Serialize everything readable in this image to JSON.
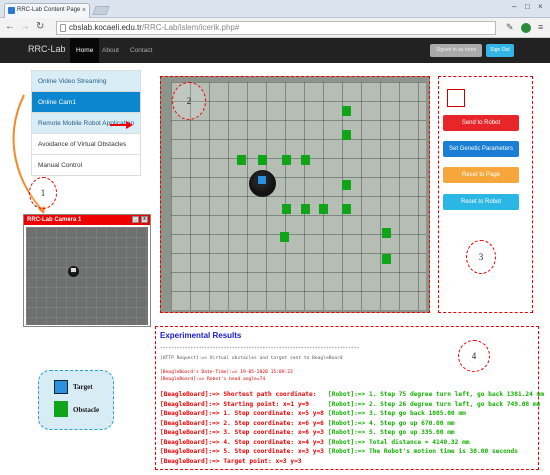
{
  "browser": {
    "tab_title": "RRC-Lab Content Page",
    "tab_close": "×",
    "url_host": "cbslab.kocaeli.edu.tr",
    "url_path": "/RRC-Lab/islem/icerik.php#",
    "back_icon": "arrow-left",
    "forward_icon": "arrow-right",
    "reload_icon": "reload",
    "window_controls": [
      "–",
      "□",
      "×"
    ]
  },
  "navbar": {
    "brand": "RRC-Lab",
    "links": [
      "Home",
      "About",
      "Contact"
    ],
    "signed_in": "Signed in as robot",
    "sign_out": "Sign Out"
  },
  "menu": {
    "items": [
      "Online Video Streaming",
      "Online Cam1",
      "Remote Mobile Robot Application",
      "Avoidance of Virtual Obstacles",
      "Manual Control"
    ]
  },
  "annotations": [
    "1",
    "2",
    "3",
    "4"
  ],
  "camera": {
    "title": "RRC-Lab Camera 1",
    "minimize": "_",
    "close": "x"
  },
  "legend": {
    "target": "Target",
    "obstacle": "Obstacle"
  },
  "buttons": {
    "send": "Send to Robot",
    "genetic": "Set Genetic Parameters",
    "reset_page": "Reset to Page",
    "reset_robot": "Reset to Robot"
  },
  "colors": {
    "send": "#e8262a",
    "genetic": "#1a7fd4",
    "reset_page": "#f6a63b",
    "reset_robot": "#2bb7e6",
    "obstacle": "#10a418",
    "target": "#2d8fe0"
  },
  "results": {
    "title": "Experimental Results",
    "stars": "************************************************************************",
    "http": "[HTTP Request]:=> Virtual obstacles and target sent to BeagleBoard",
    "datetime": "[BeagleBoard's Date-Time]:=> 19-05-2020 15:09:23",
    "heading": "[BeagleBoard]:=> Robot's head angle=74",
    "board_lines": [
      "[BeagleBoard]:=> Shortest path coordinate:",
      "[BeagleBoard]:=> Starting point: x=1 y=9",
      "[BeagleBoard]:=> 1. Step coordinate: x=5 y=8",
      "[BeagleBoard]:=> 2. Step coordinate: x=6 y=6",
      "[BeagleBoard]:=> 3. Step coordinate: x=6 y=3",
      "[BeagleBoard]:=> 4. Step coordinate: x=4 y=3",
      "[BeagleBoard]:=> 5. Step coordinate: x=3 y=3",
      "[BeagleBoard]:=> Target point: x=3 y=3"
    ],
    "robot_lines": [
      "[Robot]:=> 1. Step 75 degree turn left, go back 1381.24 mm",
      "[Robot]:=> 2. Step 26 degree turn left, go back 749.08 mm",
      "[Robot]:=> 3. Step go back 1005.00 mm",
      "[Robot]:=> 4. Step go up 670.00 mm",
      "[Robot]:=> 5. Step go up 335.00 mm",
      "[Robot]:=> Total distance = 4140.32 mm",
      "[Robot]:=> The Robot's motion time is 30.00 seconds"
    ]
  }
}
